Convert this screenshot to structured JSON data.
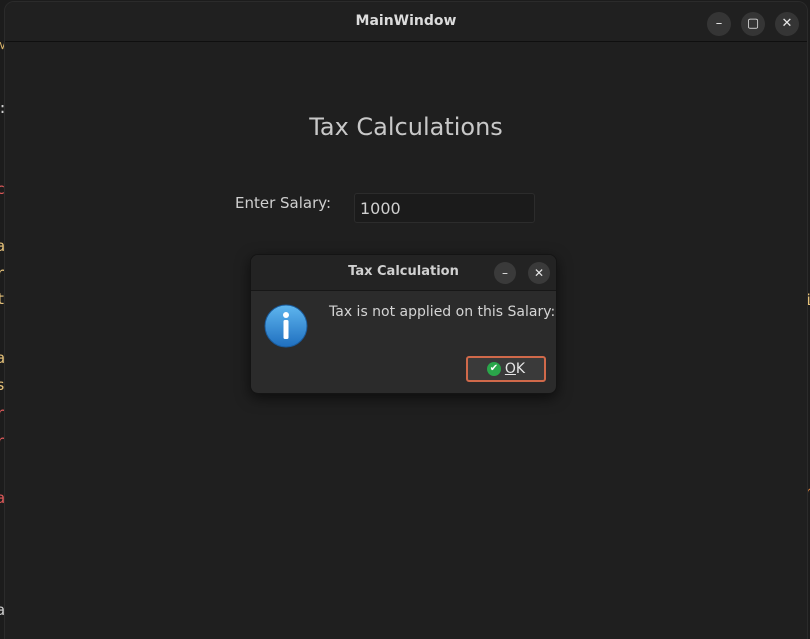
{
  "window": {
    "title": "MainWindow",
    "minimize_glyph": "–",
    "maximize_glyph": "▢",
    "close_glyph": "✕"
  },
  "main": {
    "heading": "Tax Calculations",
    "salary_label": "Enter Salary:",
    "salary_value": "1000"
  },
  "dialog": {
    "title": "Tax Calculation",
    "minimize_glyph": "–",
    "close_glyph": "✕",
    "icon": "info-icon",
    "message": "Tax is not applied on this Salary:",
    "ok_label_mnemonic": "O",
    "ok_label_rest": "K",
    "ok_icon": "checkmark-icon"
  },
  "background_fragments": {
    "left": [
      "M",
      ":",
      "c",
      "a",
      "r",
      "t",
      "a",
      "s",
      "r",
      "r",
      "a",
      "a"
    ],
    "right": [
      "i",
      "r"
    ]
  },
  "colors": {
    "accent_border": "#d0694a",
    "ok_icon_green": "#2aa64a",
    "info_blue": "#2f8fd8"
  }
}
